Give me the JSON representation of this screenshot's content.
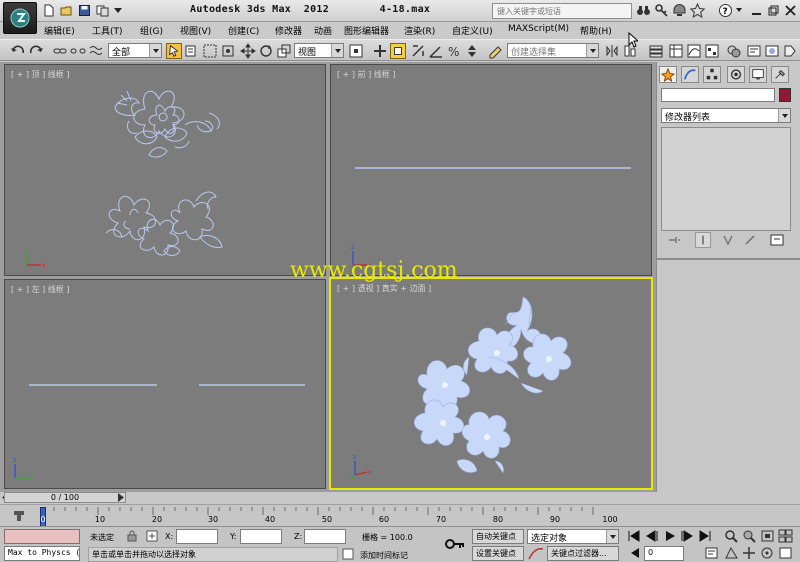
{
  "titlebar": {
    "title": "Autodesk 3ds Max  2012",
    "filename": "4-18.max",
    "search_placeholder": "键入关键字或短语"
  },
  "menu": {
    "items": [
      "编辑(E)",
      "工具(T)",
      "组(G)",
      "视图(V)",
      "创建(C)",
      "修改器",
      "动画",
      "图形编辑器",
      "渲染(R)",
      "自定义(U)",
      "MAXScript(M)",
      "帮助(H)"
    ]
  },
  "toolbar": {
    "filter_value": "全部",
    "refcoord_value": "视图",
    "selset_placeholder": "创建选择集"
  },
  "viewports": {
    "top_label": "[ + ] 顶 ] 线框 ]",
    "front_label": "[ + ] 前 ] 线框 ]",
    "left_label": "[ + ] 左 ] 线框 ]",
    "persp_label": "[ + ] 透视 ] 真实 + 边面 ]"
  },
  "watermark": "www.cgtsj.com",
  "command_panel": {
    "modifier_list": "修改器列表",
    "object_color": "#8e1a36"
  },
  "timeline": {
    "frame_readout": "0 / 100",
    "ticks": [
      "0",
      "10",
      "20",
      "30",
      "40",
      "50",
      "60",
      "70",
      "80",
      "90",
      "100"
    ]
  },
  "status": {
    "maxscript_text": "Max to Physcs (",
    "selection_text": "未选定",
    "prompt_text": "单击或单击并拖动以选择对象",
    "x_label": "X:",
    "y_label": "Y:",
    "z_label": "Z:",
    "grid_text": "栅格 = 100.0",
    "add_time_tag": "添加时间标记",
    "auto_key": "自动关键点",
    "set_key": "设置关键点",
    "selected_object": "选定对象",
    "key_filters": "关键点过滤器...",
    "current_frame": "0"
  },
  "colors": {
    "viewport_bg": "#7c7c7c",
    "active_border": "#e8e800",
    "wire": "#b8c8ee",
    "flower_fill": "#c8d8f8"
  }
}
